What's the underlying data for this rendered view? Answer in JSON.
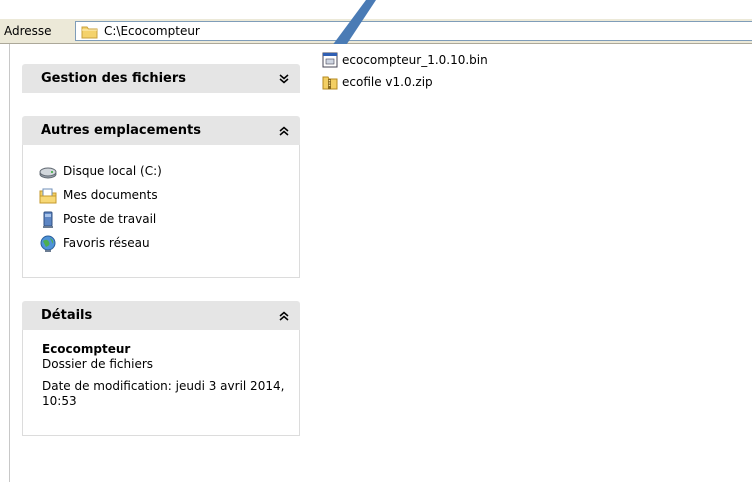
{
  "address_bar": {
    "label": "Adresse",
    "path": "C:\\Ecocompteur"
  },
  "task_panels": {
    "file_management": {
      "title": "Gestion des fichiers"
    },
    "other_places": {
      "title": "Autres emplacements",
      "items": [
        {
          "label": "Disque local (C:)",
          "icon": "local-disk-icon"
        },
        {
          "label": "Mes documents",
          "icon": "my-documents-icon"
        },
        {
          "label": "Poste de travail",
          "icon": "my-computer-icon"
        },
        {
          "label": "Favoris réseau",
          "icon": "network-places-icon"
        }
      ]
    },
    "details": {
      "title": "Détails",
      "name": "Ecocompteur",
      "type": "Dossier de fichiers",
      "modified": "Date de modification: jeudi 3 avril 2014, 10:53"
    }
  },
  "files": [
    {
      "name": "ecocompteur_1.0.10.bin",
      "icon": "bin-file-icon"
    },
    {
      "name": "ecofile v1.0.zip",
      "icon": "zip-folder-icon"
    }
  ],
  "colors": {
    "panel_header": "#e5e5e5",
    "panel_border": "#dcdcdc",
    "address_bg": "#ece9d8",
    "pointer": "#3b6fa6"
  }
}
